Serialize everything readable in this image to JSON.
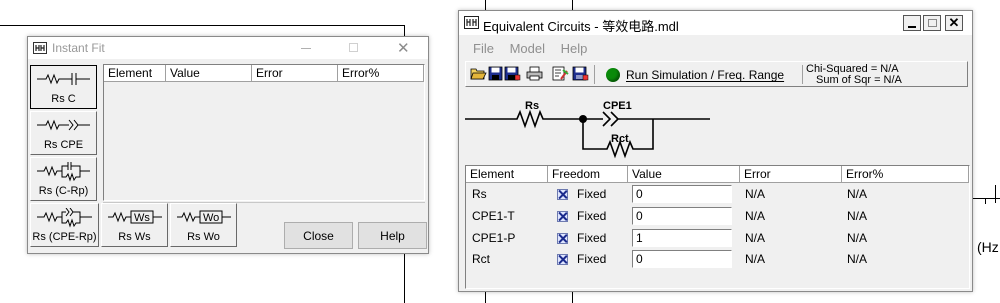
{
  "background": {
    "axis_unit_label": "(Hz"
  },
  "instant_fit": {
    "title": "Instant Fit",
    "circuit_buttons": [
      {
        "label": "Rs C"
      },
      {
        "label": "Rs CPE"
      },
      {
        "label": "Rs (C-Rp)"
      },
      {
        "label": "Rs (CPE-Rp)"
      },
      {
        "label": "Rs Ws"
      },
      {
        "label": "Rs Wo"
      }
    ],
    "table_headers": [
      "Element",
      "Value",
      "Error",
      "Error%"
    ],
    "close_label": "Close",
    "help_label": "Help"
  },
  "equiv": {
    "title": "Equivalent Circuits - 等效电路.mdl",
    "menu": [
      "File",
      "Model",
      "Help"
    ],
    "run_label": "Run Simulation / Freq. Range",
    "chi_squared": "Chi-Squared = N/A",
    "sum_of_sqr": "Sum of Sqr = N/A",
    "circuit_labels": {
      "rs": "Rs",
      "cpe1": "CPE1",
      "rct": "Rct"
    },
    "table_headers": [
      "Element",
      "Freedom",
      "Value",
      "Error",
      "Error%"
    ],
    "rows": [
      {
        "element": "Rs",
        "freedom": "Fixed",
        "value": "0",
        "error": "N/A",
        "error_pct": "N/A"
      },
      {
        "element": "CPE1-T",
        "freedom": "Fixed",
        "value": "0",
        "error": "N/A",
        "error_pct": "N/A"
      },
      {
        "element": "CPE1-P",
        "freedom": "Fixed",
        "value": "1",
        "error": "N/A",
        "error_pct": "N/A"
      },
      {
        "element": "Rct",
        "freedom": "Fixed",
        "value": "0",
        "error": "N/A",
        "error_pct": "N/A"
      }
    ],
    "colors": {
      "run_indicator": "#0a8a0a"
    }
  }
}
